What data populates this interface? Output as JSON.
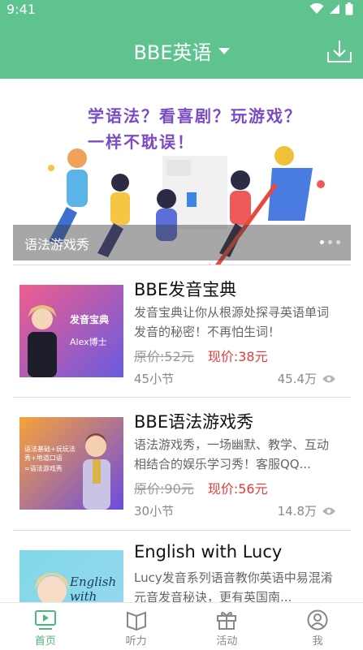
{
  "status": {
    "time": "9:41"
  },
  "header": {
    "title": "BBE英语"
  },
  "banner": {
    "line1": "学语法？看喜剧？玩游戏？",
    "line2": "一样不耽误！",
    "label": "语法游戏秀"
  },
  "courses": [
    {
      "title": "BBE发音宝典",
      "desc": "发音宝典让你从根源处探寻英语单词发音的秘密！不再怕生词！",
      "orig_price": "原价:52元",
      "now_price": "现价:38元",
      "lessons": "45小节",
      "views": "45.4万",
      "thumb_text1": "发音宝典",
      "thumb_text2": "Alex博士"
    },
    {
      "title": "BBE语法游戏秀",
      "desc": "语法游戏秀，一场幽默、教学、互动相结合的娱乐学习秀！客服QQ...",
      "orig_price": "原价:90元",
      "now_price": "现价:56元",
      "lessons": "30小节",
      "views": "14.8万",
      "thumb_text1": "语法基础+玩玩法秀+地道口语",
      "thumb_text2": "=语法游戏秀"
    },
    {
      "title": "English with Lucy",
      "desc": "Lucy发音系列语音教你英语中易混淆元音发音秘诀，更有英国南...",
      "thumb_text1": "English with Lucy"
    }
  ],
  "nav": [
    {
      "label": "首页",
      "icon": "home-video-icon",
      "active": true
    },
    {
      "label": "听力",
      "icon": "book-icon",
      "active": false
    },
    {
      "label": "活动",
      "icon": "gift-icon",
      "active": false
    },
    {
      "label": "我",
      "icon": "user-icon",
      "active": false
    }
  ],
  "colors": {
    "primary": "#5ec38f",
    "price": "#e63a3a",
    "active_nav": "#4db77f"
  }
}
